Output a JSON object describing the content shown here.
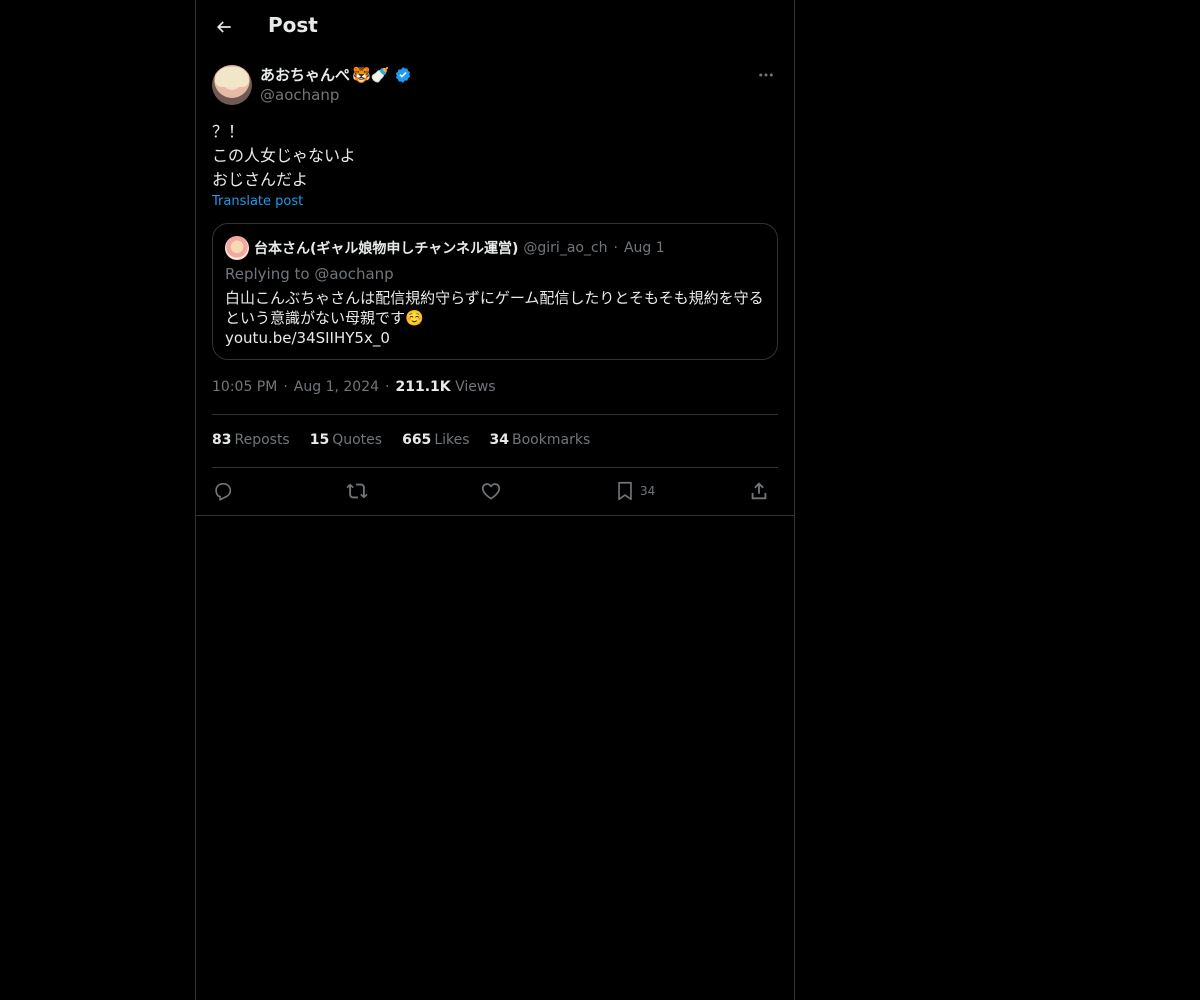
{
  "header": {
    "title": "Post"
  },
  "author": {
    "name": "あおちゃんぺ",
    "name_emoji": "🐯🍼",
    "handle": "@aochanp",
    "verified_color": "#1d9bf0"
  },
  "post": {
    "lines": [
      "？！",
      "この人女じゃないよ",
      "おじさんだよ"
    ],
    "translate_label": "Translate post"
  },
  "quote": {
    "name": "台本さん(ギャル娘物申しチャンネル運営)",
    "handle": "@giri_ao_ch",
    "dot": "·",
    "date": "Aug 1",
    "replying_to": "Replying to @aochanp",
    "lines": [
      "白山こんぶちゃさんは配信規約守らずにゲーム配信したりとそもそも規約を守る",
      "という意識がない母親です☺️",
      "youtu.be/34SIIHY5x_0"
    ]
  },
  "meta": {
    "time": "10:05 PM",
    "sep": "·",
    "date": "Aug 1, 2024",
    "views_count": "211.1K",
    "views_label": "Views"
  },
  "stats": [
    {
      "count": "83",
      "label": "Reposts"
    },
    {
      "count": "15",
      "label": "Quotes"
    },
    {
      "count": "665",
      "label": "Likes"
    },
    {
      "count": "34",
      "label": "Bookmarks"
    }
  ],
  "actions": {
    "reply_icon": "reply-icon",
    "repost_icon": "repost-icon",
    "like_icon": "heart-icon",
    "bookmark_icon": "bookmark-icon",
    "bookmark_count": "34",
    "share_icon": "share-icon"
  },
  "colors": {
    "background": "#000000",
    "text": "#e7e9ea",
    "muted": "#71767b",
    "border": "#2f3336",
    "accent": "#1d9bf0"
  }
}
